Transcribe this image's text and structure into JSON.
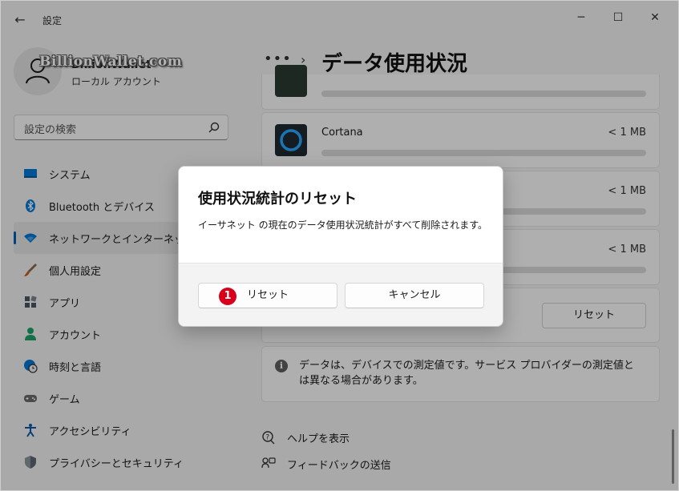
{
  "window": {
    "title": "設定",
    "back_icon": "back-arrow-icon",
    "controls": {
      "minimize": "─",
      "maximize": "☐",
      "close": "✕"
    }
  },
  "profile": {
    "name": "BillionWallet",
    "account_type": "ローカル アカウント",
    "watermark": "BillionWallet.com"
  },
  "search": {
    "placeholder": "設定の検索",
    "icon": "search-icon"
  },
  "sidebar": {
    "items": [
      {
        "label": "システム",
        "icon": "system-icon",
        "color": "#0078d4"
      },
      {
        "label": "Bluetooth とデバイス",
        "icon": "bluetooth-icon",
        "color": "#0078d4"
      },
      {
        "label": "ネットワークとインターネット",
        "icon": "network-icon",
        "color": "#0078d4",
        "active": true
      },
      {
        "label": "個人用設定",
        "icon": "brush-icon",
        "color": "#c75d1a"
      },
      {
        "label": "アプリ",
        "icon": "apps-icon",
        "color": "#4a5560"
      },
      {
        "label": "アカウント",
        "icon": "account-icon",
        "color": "#1aa267"
      },
      {
        "label": "時刻と言語",
        "icon": "globe-clock-icon",
        "color": "#0078d4"
      },
      {
        "label": "ゲーム",
        "icon": "gamepad-icon",
        "color": "#6b6b6b"
      },
      {
        "label": "アクセシビリティ",
        "icon": "accessibility-icon",
        "color": "#0b5cad"
      },
      {
        "label": "プライバシーとセキュリティ",
        "icon": "shield-icon",
        "color": "#5c6670"
      }
    ]
  },
  "breadcrumb": {
    "more": "•••",
    "separator": "›",
    "title": "データ使用状況"
  },
  "apps": [
    {
      "name": "",
      "usage": ""
    },
    {
      "name": "Cortana",
      "usage": "< 1 MB"
    },
    {
      "name": "",
      "usage": "< 1 MB"
    },
    {
      "name": "",
      "usage": "< 1 MB"
    }
  ],
  "reset_section": {
    "button_label": "リセット"
  },
  "info": {
    "icon": "info-icon",
    "text": "データは、デバイスでの測定値です。サービス プロバイダーの測定値とは異なる場合があります。"
  },
  "links": [
    {
      "label": "ヘルプを表示",
      "icon": "help-icon"
    },
    {
      "label": "フィードバックの送信",
      "icon": "feedback-icon"
    }
  ],
  "dialog": {
    "title": "使用状況統計のリセット",
    "message": "イーサネット の現在のデータ使用状況統計がすべて削除されます。",
    "reset_label": "リセット",
    "cancel_label": "キャンセル",
    "step_badge": "1",
    "badge_color": "#d9001b"
  }
}
